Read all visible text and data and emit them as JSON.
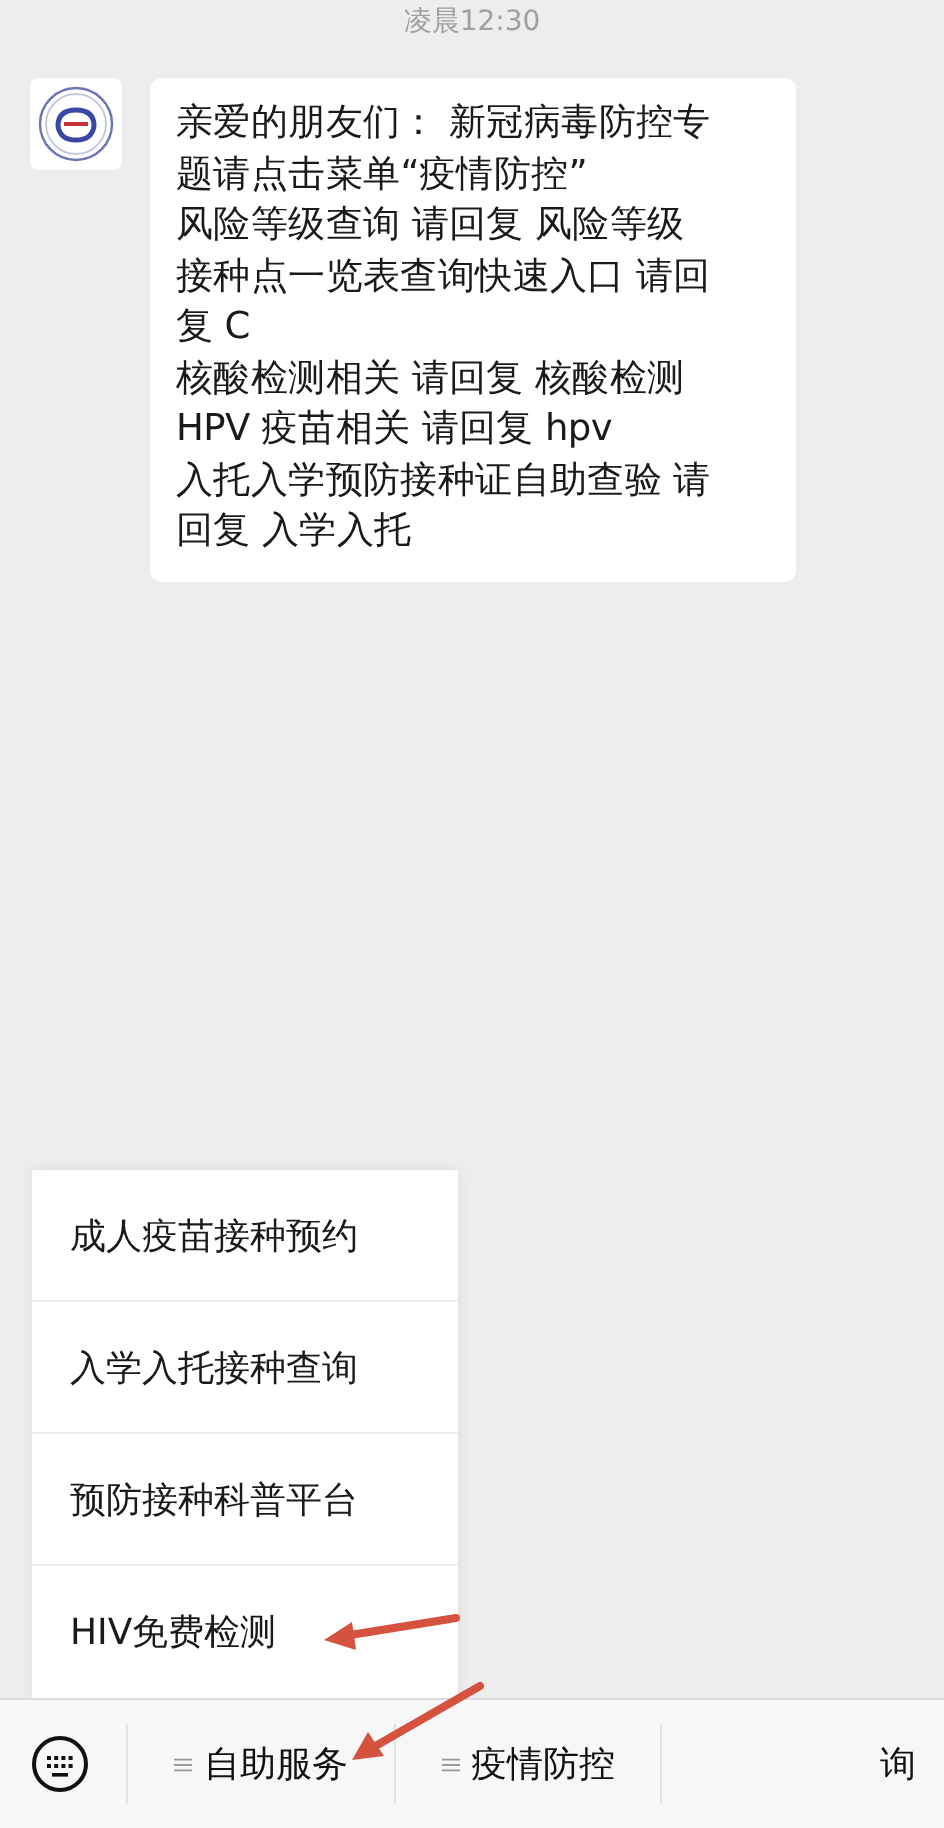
{
  "timestamp": "凌晨12:30",
  "message": {
    "lines": [
      "亲爱的朋友们：  新冠病毒防控专",
      "题请点击菜单“疫情防控”",
      "风险等级查询 请回复 风险等级",
      "接种点一览表查询快速入口 请回",
      "复 C",
      "核酸检测相关 请回复 核酸检测",
      "HPV 疫苗相关 请回复 hpv",
      "入托入学预防接种证自助查验 请",
      "回复 入学入托"
    ]
  },
  "popup_menu": {
    "items": [
      {
        "label": "成人疫苗接种预约"
      },
      {
        "label": "入学入托接种查询"
      },
      {
        "label": "预防接种科普平台"
      },
      {
        "label": "HIV免费检测"
      }
    ]
  },
  "menu_bar": {
    "items": [
      {
        "label": "自助服务",
        "kind": "menu"
      },
      {
        "label": "疫情防控",
        "kind": "menu"
      },
      {
        "label": "询",
        "kind": "partial"
      }
    ]
  }
}
